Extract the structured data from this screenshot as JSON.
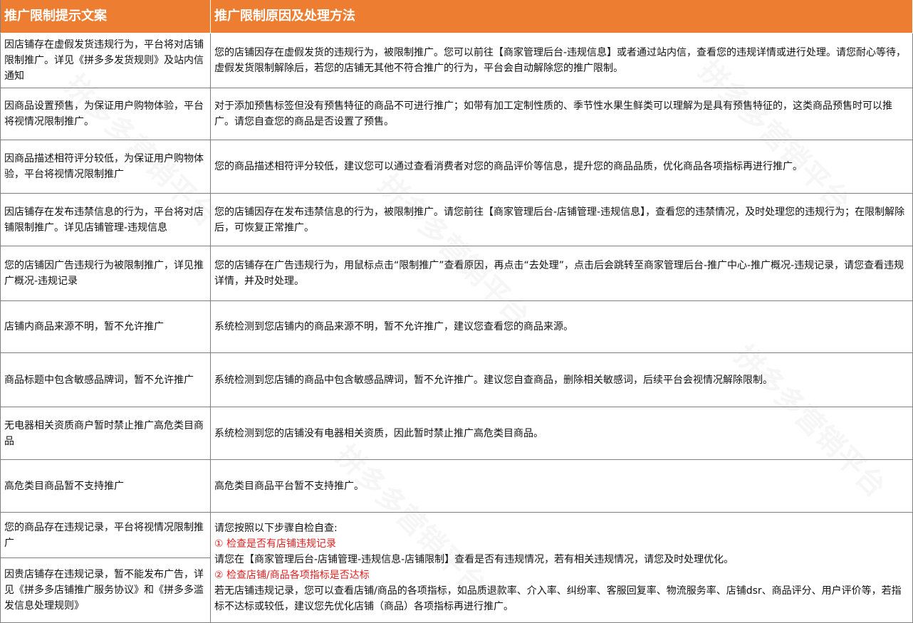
{
  "header": {
    "col1": "推广限制提示文案",
    "col2": "推广限制原因及处理方法"
  },
  "rows": [
    {
      "tip": "因店铺存在虚假发货违规行为，平台将对店铺限制推广。详见《拼多多发货规则》及站内信通知",
      "solution": "您的店铺因存在虚假发货的违规行为，被限制推广。您可以前往【商家管理后台-违规信息】或者通过站内信，查看您的违规详情或进行处理。请您耐心等待，虚假发货限制解除后，若您的店铺无其他不符合推广的行为，平台会自动解除您的推广限制。"
    },
    {
      "tip": "因商品设置预售，为保证用户购物体验，平台将视情况限制推广。",
      "solution": "对于添加预售标签但没有预售特征的商品不可进行推广；如带有加工定制性质的、季节性水果生鲜类可以理解为是具有预售特征的，这类商品预售时可以推广。请您自查您的商品是否设置了预售。"
    },
    {
      "tip": "因商品描述相符评分较低，为保证用户购物体验，平台将视情况限制推广",
      "solution": "您的商品描述相符评分较低，建议您可以通过查看消费者对您的商品评价等信息，提升您的商品品质，优化商品各项指标再进行推广。"
    },
    {
      "tip": "因店铺存在发布违禁信息的行为，平台将对店铺限制推广。详见店铺管理-违规信息",
      "solution": "您的店铺因存在发布违禁信息的行为，被限制推广。请您前往【商家管理后台-店铺管理-违规信息】，查看您的违禁情况，及时处理您的违规行为；在限制解除后，可恢复正常推广。"
    },
    {
      "tip": "您的店铺因广告违规行为被限制推广，详见推广概况-违规记录",
      "solution": "您的店铺存在广告违规行为，用鼠标点击“限制推广”查看原因，再点击“去处理”，点击后会跳转至商家管理后台-推广中心-推广概况-违规记录，请您查看违规详情，并及时处理。"
    },
    {
      "tip": "店铺内商品来源不明，暂不允许推广",
      "solution": "系统检测到您店铺内的商品来源不明，暂不允许推广，建议您查看您的商品来源。"
    },
    {
      "tip": "商品标题中包含敏感品牌词，暂不允许推广",
      "solution": "系统检测到您店铺的商品中包含敏感品牌词，暂不允许推广。建议您自查商品，删除相关敏感词，后续平台会视情况解除限制。"
    },
    {
      "tip": "无电器相关资质商户暂时禁止推广高危类目商品",
      "solution": "系统检测到您的店铺没有电器相关资质，因此暂时禁止推广高危类目商品。"
    },
    {
      "tip": "高危类目商品暂不支持推广",
      "solution": "高危类目商品平台暂不支持推广。"
    }
  ],
  "merged": {
    "tips": [
      "您的商品存在违规记录，平台将视情况限制推广",
      "因贵店铺存在违规记录，暂不能发布广告，详见《拼多多店铺推广服务协议》和《拼多多滥发信息处理规则》"
    ],
    "intro": "请您按照以下步骤自检自查:",
    "step1_title": "① 检查是否有店铺违规记录",
    "step1_text": "请您在【商家管理后台-店铺管理-违规信息-店铺限制】查看是否有违规情况，若有相关违规情况，请您及时处理优化。",
    "step2_title": "② 检查店铺/商品各项指标是否达标",
    "step2_text": "若无店铺违规记录，您可以查看店铺/商品的各项指标，如品质退款率、介入率、纠纷率、客服回复率、物流服务率、店铺dsr、商品评分、用户评价等，若指标不达标或较低，建议您先优化店铺（商品）各项指标再进行推广。"
  },
  "watermark": "拼多多营销平台",
  "colors": {
    "header_bg": "#ed7d31",
    "header_text": "#ffffff",
    "step_title": "#e02020",
    "grid": "#7f7f7f"
  }
}
